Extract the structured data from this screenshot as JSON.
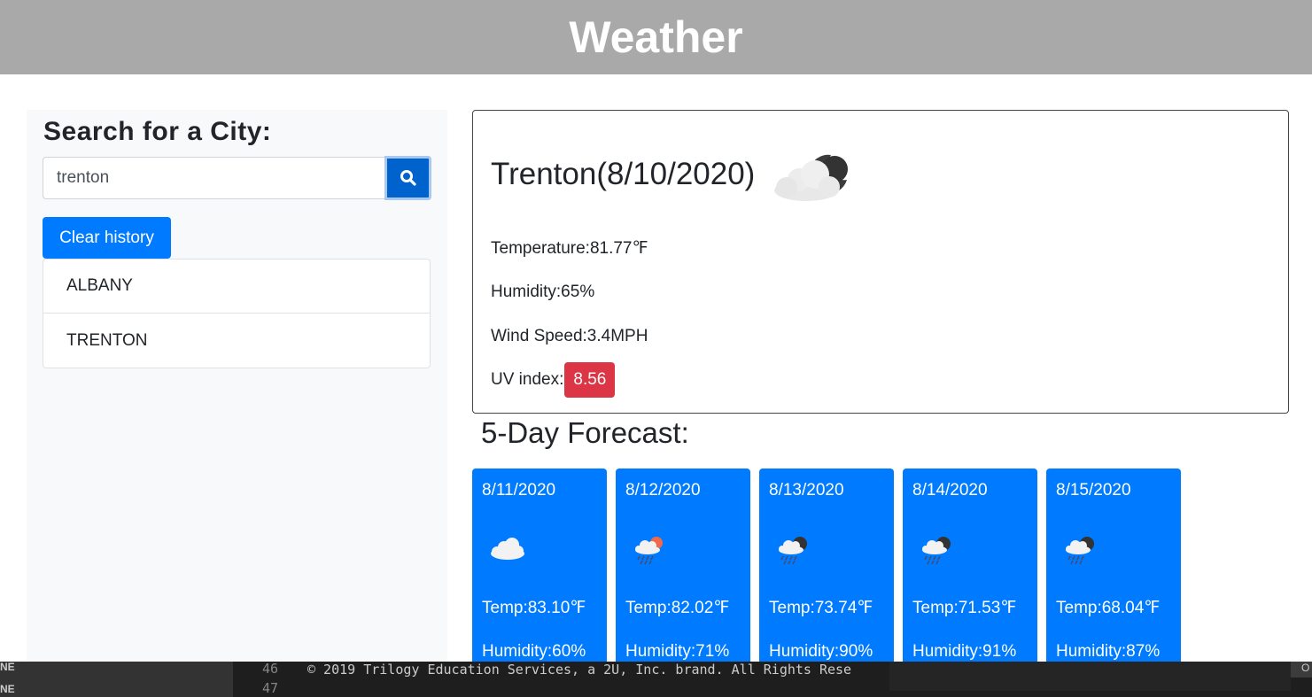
{
  "header": {
    "title": "Weather"
  },
  "sidebar": {
    "heading": "Search for a City:",
    "search": {
      "value": "trenton",
      "placeholder": ""
    },
    "clear_label": "Clear history",
    "history": [
      "ALBANY",
      "TRENTON"
    ]
  },
  "current": {
    "city_date": "Trenton(8/10/2020)",
    "icon": "night-cloudy-icon",
    "temperature_label": "Temperature:",
    "temperature": "81.77",
    "unit": "℉",
    "humidity": "Humidity:65%",
    "wind": "Wind Speed:3.4MPH",
    "uv_label": "UV index:",
    "uv_value": "8.56"
  },
  "forecast": {
    "title": "5-Day Forecast:",
    "days": [
      {
        "date": "8/11/2020",
        "icon": "cloud-icon",
        "temp": "Temp:83.10",
        "unit": "℉",
        "humidity": "Humidity:60%"
      },
      {
        "date": "8/12/2020",
        "icon": "rain-sun-icon",
        "temp": "Temp:82.02",
        "unit": "℉",
        "humidity": "Humidity:71%"
      },
      {
        "date": "8/13/2020",
        "icon": "rain-night-icon",
        "temp": "Temp:73.74",
        "unit": "℉",
        "humidity": "Humidity:90%"
      },
      {
        "date": "8/14/2020",
        "icon": "rain-night-icon",
        "temp": "Temp:71.53",
        "unit": "℉",
        "humidity": "Humidity:91%"
      },
      {
        "date": "8/15/2020",
        "icon": "rain-night-icon",
        "temp": "Temp:68.04",
        "unit": "℉",
        "humidity": "Humidity:87%"
      }
    ]
  },
  "editor": {
    "side_labels": [
      "NE",
      "NE"
    ],
    "line_numbers": [
      "46",
      "47"
    ],
    "code_line": "© 2019 Trilogy Education Services, a 2U, Inc. brand. All Rights Rese",
    "corner": "O"
  },
  "colors": {
    "header": "#a9a9a9",
    "primary": "#007bff",
    "danger": "#dc3545",
    "sidebar": "#f8f9fa"
  }
}
